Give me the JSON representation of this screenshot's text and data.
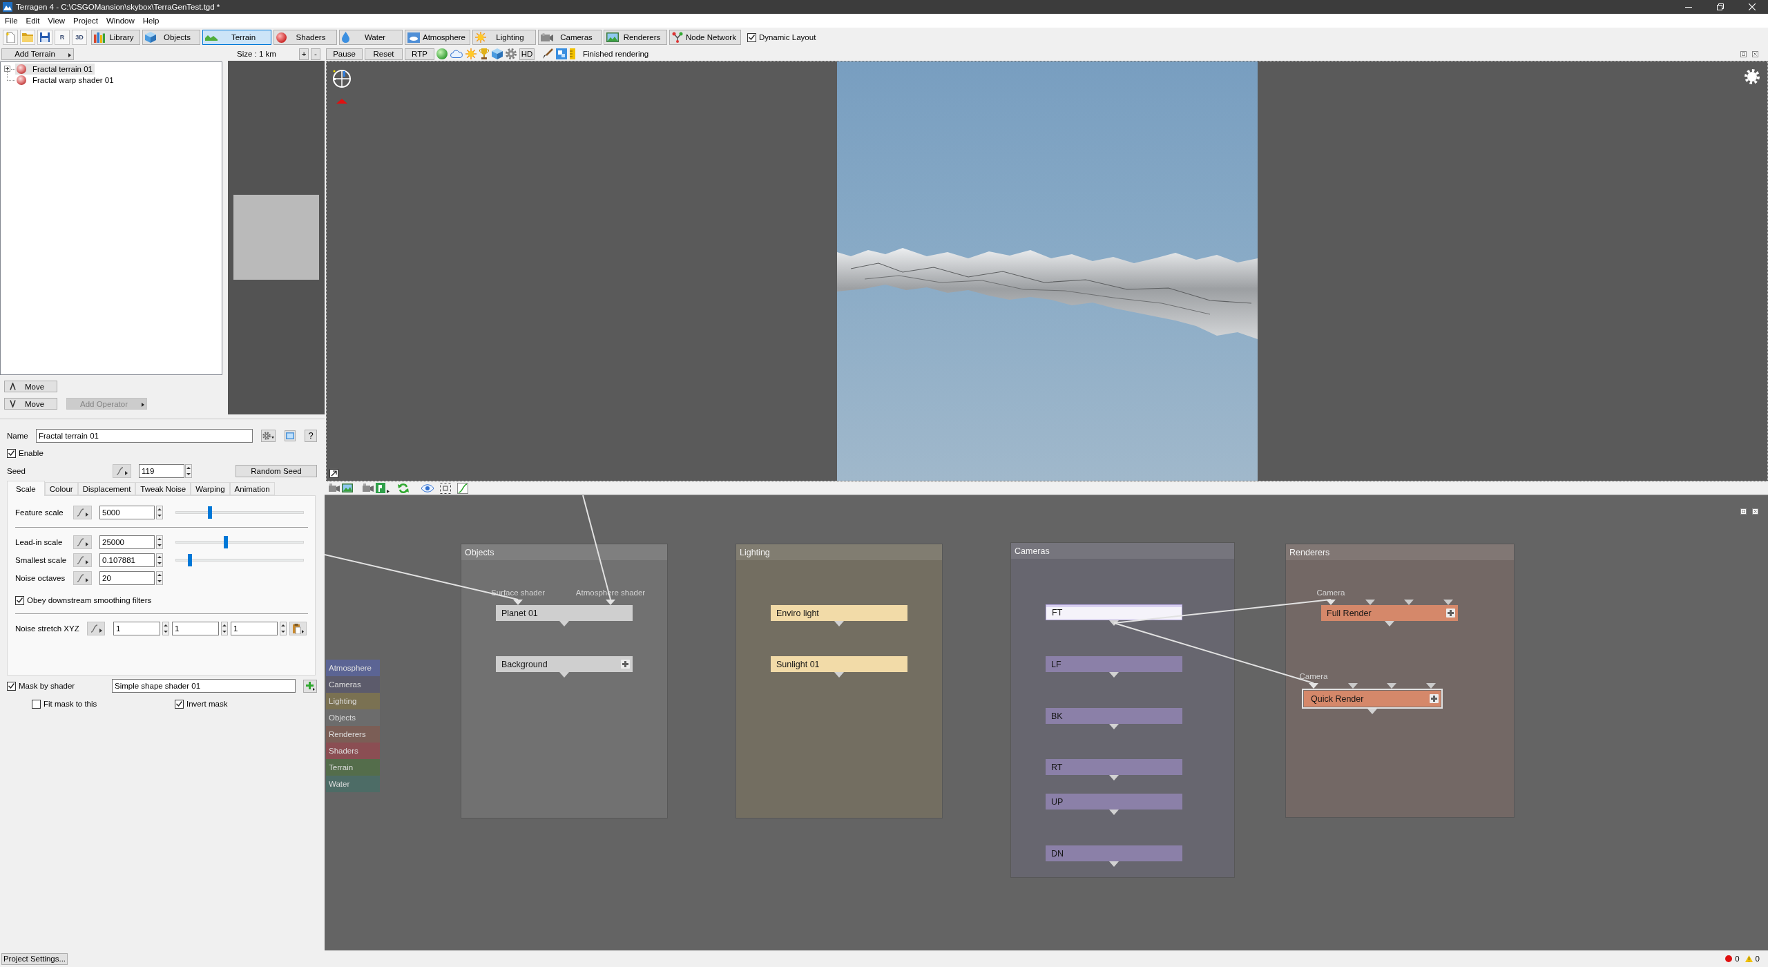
{
  "window": {
    "title": "Terragen 4 - C:\\CSGOMansion\\skybox\\TerraGenTest.tgd *"
  },
  "menu": [
    "File",
    "Edit",
    "View",
    "Project",
    "Window",
    "Help"
  ],
  "toolbar": {
    "text_buttons": [
      "R",
      "3D"
    ],
    "tabs": [
      {
        "label": "Library",
        "selected": false
      },
      {
        "label": "Objects",
        "selected": false
      },
      {
        "label": "Terrain",
        "selected": true
      },
      {
        "label": "Shaders",
        "selected": false
      },
      {
        "label": "Water",
        "selected": false
      },
      {
        "label": "Atmosphere",
        "selected": false
      },
      {
        "label": "Lighting",
        "selected": false
      },
      {
        "label": "Cameras",
        "selected": false
      },
      {
        "label": "Renderers",
        "selected": false
      },
      {
        "label": "Node Network",
        "selected": false
      }
    ],
    "dynamic_layout": {
      "label": "Dynamic Layout",
      "checked": true
    }
  },
  "scene_panel": {
    "add_button": "Add Terrain",
    "tree": [
      {
        "label": "Fractal terrain 01",
        "selected": true,
        "kind": "branch",
        "expanded": false
      },
      {
        "label": "Fractal warp shader 01",
        "selected": false,
        "kind": "leaf"
      }
    ],
    "move_buttons": [
      {
        "label": "Move",
        "kind": "up"
      },
      {
        "label": "Move",
        "kind": "down"
      }
    ],
    "add_operator": {
      "label": "Add Operator",
      "disabled": true
    }
  },
  "viewport": {
    "size_label": "Size : 1 km",
    "buttons": [
      "+",
      "-",
      "Pause",
      "Reset",
      "RTP"
    ],
    "quality_button": "HD",
    "status": "Finished rendering"
  },
  "properties": {
    "name": {
      "label": "Name",
      "value": "Fractal terrain 01"
    },
    "help_button": "?",
    "enable": {
      "label": "Enable",
      "checked": true
    },
    "seed": {
      "label": "Seed",
      "value": "119",
      "button": "Random Seed"
    },
    "tabs": [
      {
        "label": "Scale",
        "selected": true
      },
      {
        "label": "Colour",
        "selected": false
      },
      {
        "label": "Displacement",
        "selected": false
      },
      {
        "label": "Tweak Noise",
        "selected": false
      },
      {
        "label": "Warping",
        "selected": false
      },
      {
        "label": "Animation",
        "selected": false
      }
    ],
    "sections": [
      {
        "params": [
          {
            "kind": "slider",
            "label": "Feature scale",
            "value": "5000",
            "level": 0.26
          }
        ]
      },
      {
        "params": [
          {
            "kind": "slider",
            "label": "Lead-in scale",
            "value": "25000",
            "level": 0.39
          },
          {
            "kind": "slider",
            "label": "Smallest scale",
            "value": "0.107881",
            "level": 0.1
          },
          {
            "kind": "number",
            "label": "Noise octaves",
            "value": "20"
          },
          {
            "kind": "checkbox",
            "label": "Obey downstream smoothing filters",
            "checked": true
          }
        ]
      },
      {
        "params": [
          {
            "kind": "vector",
            "label": "Noise stretch XYZ",
            "values": [
              "1",
              "1",
              "1"
            ]
          }
        ]
      }
    ],
    "mask": {
      "label": "Mask by shader",
      "checked": true,
      "shader": "Simple shape shader 01",
      "options": [
        {
          "label": "Fit mask to this",
          "checked": false
        },
        {
          "label": "Invert mask",
          "checked": true
        }
      ]
    }
  },
  "node_network": {
    "legend": [
      {
        "label": "Atmosphere",
        "color": "#5b6494"
      },
      {
        "label": "Cameras",
        "color": "#5c5b6b"
      },
      {
        "label": "Lighting",
        "color": "#7a7152"
      },
      {
        "label": "Objects",
        "color": "#6c6c6c"
      },
      {
        "label": "Renderers",
        "color": "#7b5e56"
      },
      {
        "label": "Shaders",
        "color": "#8b4e53"
      },
      {
        "label": "Terrain",
        "color": "#546d4b"
      },
      {
        "label": "Water",
        "color": "#4d6c66"
      }
    ],
    "groups": [
      {
        "title": "Objects",
        "color": "#717171",
        "nodes": [
          {
            "label": "Planet 01",
            "color": "#cfcfcf",
            "selected": false,
            "outlined": false,
            "add_button": false,
            "inputs": [
              {
                "label": "Surface shader",
                "connected": true
              },
              {
                "label": "Atmosphere shader",
                "connected": true
              }
            ]
          },
          {
            "label": "Background",
            "color": "#cfcfcf",
            "selected": false,
            "outlined": false,
            "add_button": true
          }
        ]
      },
      {
        "title": "Lighting",
        "color": "#736e61",
        "nodes": [
          {
            "label": "Enviro light",
            "color": "#f2dba8",
            "selected": false,
            "outlined": false,
            "add_button": false
          },
          {
            "label": "Sunlight 01",
            "color": "#f2dba8",
            "selected": false,
            "outlined": false,
            "add_button": false
          }
        ]
      },
      {
        "title": "Cameras",
        "color": "#67666f",
        "nodes": [
          {
            "label": "FT",
            "color": "#f5f3fa",
            "selected": true,
            "outlined": false,
            "add_button": false
          },
          {
            "label": "LF",
            "color": "#8b80a8",
            "selected": false,
            "outlined": false,
            "add_button": false
          },
          {
            "label": "BK",
            "color": "#8b80a8",
            "selected": false,
            "outlined": false,
            "add_button": false
          },
          {
            "label": "RT",
            "color": "#8b80a8",
            "selected": false,
            "outlined": false,
            "add_button": false
          },
          {
            "label": "UP",
            "color": "#8b80a8",
            "selected": false,
            "outlined": false,
            "add_button": false
          },
          {
            "label": "DN",
            "color": "#8b80a8",
            "selected": false,
            "outlined": false,
            "add_button": false
          }
        ]
      },
      {
        "title": "Renderers",
        "color": "#736865",
        "nodes": [
          {
            "label": "Full Render",
            "color": "#d5886a",
            "selected": false,
            "outlined": false,
            "add_button": true,
            "inputs": [
              {
                "label": "Camera",
                "connected": true
              },
              {
                "connected": false
              },
              {
                "connected": false
              },
              {
                "connected": false
              }
            ]
          },
          {
            "label": "Quick Render",
            "color": "#d5886a",
            "selected": false,
            "outlined": true,
            "add_button": true,
            "inputs": [
              {
                "label": "Camera",
                "connected": true
              },
              {
                "connected": false
              },
              {
                "connected": false
              },
              {
                "connected": false
              }
            ]
          }
        ]
      }
    ]
  },
  "status_bar": {
    "project_settings": "Project Settings...",
    "error_count": "0",
    "warning_count": "0"
  }
}
